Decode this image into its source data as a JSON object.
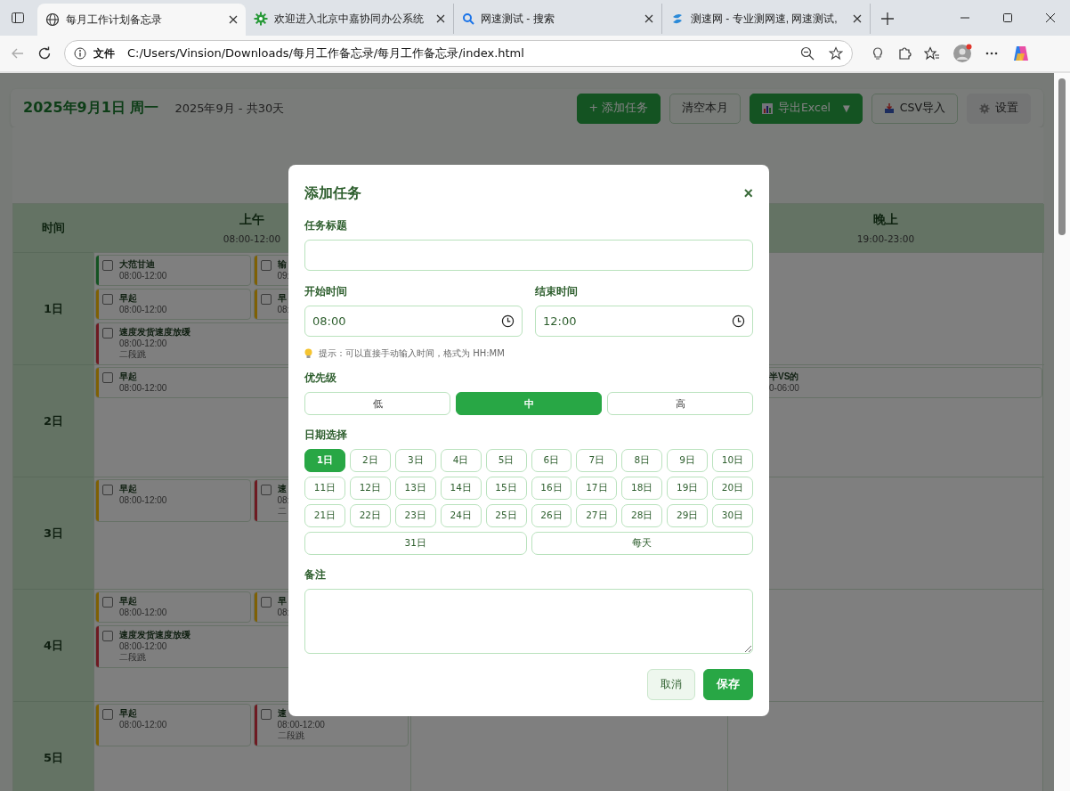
{
  "browser": {
    "tabs": [
      {
        "title": "每月工作计划备忘录",
        "selected": true
      },
      {
        "title": "欢迎进入北京中嘉协同办公系统",
        "selected": false
      },
      {
        "title": "网速测试 - 搜索",
        "selected": false
      },
      {
        "title": "测速网 - 专业测网速, 网速测试,",
        "selected": false
      }
    ],
    "address": {
      "scheme": "文件",
      "url": "C:/Users/Vinsion/Downloads/每月工作备忘录/每月工作备忘录/index.html"
    }
  },
  "header": {
    "date": "2025年9月1日 周一",
    "summary": "2025年9月 - 共30天",
    "buttons": [
      {
        "label": "+ 添加任务",
        "kind": "primary"
      },
      {
        "label": "清空本月",
        "kind": "outline"
      },
      {
        "label": "导出Excel",
        "kind": "export",
        "caret": "▼"
      },
      {
        "label": "CSV导入",
        "kind": "import"
      },
      {
        "label": "设置",
        "kind": "settings"
      }
    ]
  },
  "table": {
    "time_heading": "时间",
    "morning": {
      "label": "上午",
      "range": "08:00-12:00"
    },
    "evening": {
      "label": "晚上",
      "range": "19:00-23:00"
    },
    "rows": [
      {
        "day": "1日",
        "morning": [
          {
            "title": "大范甘迪",
            "time": "08:00-12:00",
            "color": "#145322",
            "done": false
          },
          {
            "title": "输",
            "time": "09:",
            "color": "#7f6003",
            "done": false
          },
          {
            "title": "早起",
            "time": "08:00-12:00",
            "color": "#7f6003",
            "done": false
          },
          {
            "title": "早",
            "time": "08:",
            "color": "#7f6003",
            "done": false
          },
          {
            "title": "速度发货速度放缓",
            "time": "08:00-12:00",
            "note": "二段跳",
            "color": "#6e1a22",
            "done": false
          }
        ],
        "evening": []
      },
      {
        "day": "2日",
        "morning": [
          {
            "title": "早起",
            "time": "08:00-12:00",
            "color": "#7f6003",
            "done": false
          }
        ],
        "evening": [
          {
            "title": "半VS的",
            "time": "0-06:00"
          }
        ]
      },
      {
        "day": "3日",
        "morning": [
          {
            "title": "早起",
            "time": "08:00-12:00",
            "color": "#7f6003",
            "done": false
          },
          {
            "title": "速",
            "time": "08:",
            "note": "二",
            "color": "#6e1a22",
            "done": false
          }
        ],
        "evening": []
      },
      {
        "day": "4日",
        "morning": [
          {
            "title": "早起",
            "time": "08:00-12:00",
            "color": "#7f6003",
            "done": false
          },
          {
            "title": "早",
            "time": "08:",
            "color": "#7f6003",
            "done": false
          },
          {
            "title": "速度发货速度放缓",
            "time": "08:00-12:00",
            "note": "二段跳",
            "color": "#6e1a22",
            "done": false
          }
        ],
        "evening": []
      },
      {
        "day": "5日",
        "morning": [
          {
            "title": "早起",
            "time": "08:00-12:00",
            "color": "#7f6003",
            "done": false
          },
          {
            "title": "速",
            "time": "08:00-12:00",
            "note": "二段跳",
            "color": "#6e1a22",
            "done": false
          }
        ],
        "evening": []
      }
    ]
  },
  "modal": {
    "title": "添加任务",
    "close": "×",
    "title_label": "任务标题",
    "start_label": "开始时间",
    "start_value": "08:00",
    "end_label": "结束时间",
    "end_value": "12:00",
    "hint": "提示：可以直接手动输入时间，格式为 HH:MM",
    "priority_label": "优先级",
    "priorities": [
      {
        "label": "低",
        "selected": false
      },
      {
        "label": "中",
        "selected": true
      },
      {
        "label": "高",
        "selected": false
      }
    ],
    "date_label": "日期选择",
    "dates": [
      {
        "label": "1日",
        "selected": true
      },
      {
        "label": "2日",
        "selected": false
      },
      {
        "label": "3日",
        "selected": false
      },
      {
        "label": "4日",
        "selected": false
      },
      {
        "label": "5日",
        "selected": false
      },
      {
        "label": "6日",
        "selected": false
      },
      {
        "label": "7日",
        "selected": false
      },
      {
        "label": "8日",
        "selected": false
      },
      {
        "label": "9日",
        "selected": false
      },
      {
        "label": "10日",
        "selected": false
      },
      {
        "label": "11日",
        "selected": false
      },
      {
        "label": "12日",
        "selected": false
      },
      {
        "label": "13日",
        "selected": false
      },
      {
        "label": "14日",
        "selected": false
      },
      {
        "label": "15日",
        "selected": false
      },
      {
        "label": "16日",
        "selected": false
      },
      {
        "label": "17日",
        "selected": false
      },
      {
        "label": "18日",
        "selected": false
      },
      {
        "label": "19日",
        "selected": false
      },
      {
        "label": "20日",
        "selected": false
      },
      {
        "label": "21日",
        "selected": false
      },
      {
        "label": "22日",
        "selected": false
      },
      {
        "label": "23日",
        "selected": false
      },
      {
        "label": "24日",
        "selected": false
      },
      {
        "label": "25日",
        "selected": false
      },
      {
        "label": "26日",
        "selected": false
      },
      {
        "label": "27日",
        "selected": false
      },
      {
        "label": "28日",
        "selected": false
      },
      {
        "label": "29日",
        "selected": false
      },
      {
        "label": "30日",
        "selected": false
      },
      {
        "label": "31日",
        "selected": false
      },
      {
        "label": "每天",
        "selected": false
      }
    ],
    "note_label": "备注",
    "buttons": [
      {
        "label": "取消",
        "kind": "cancel"
      },
      {
        "label": "保存",
        "kind": "save"
      }
    ]
  }
}
